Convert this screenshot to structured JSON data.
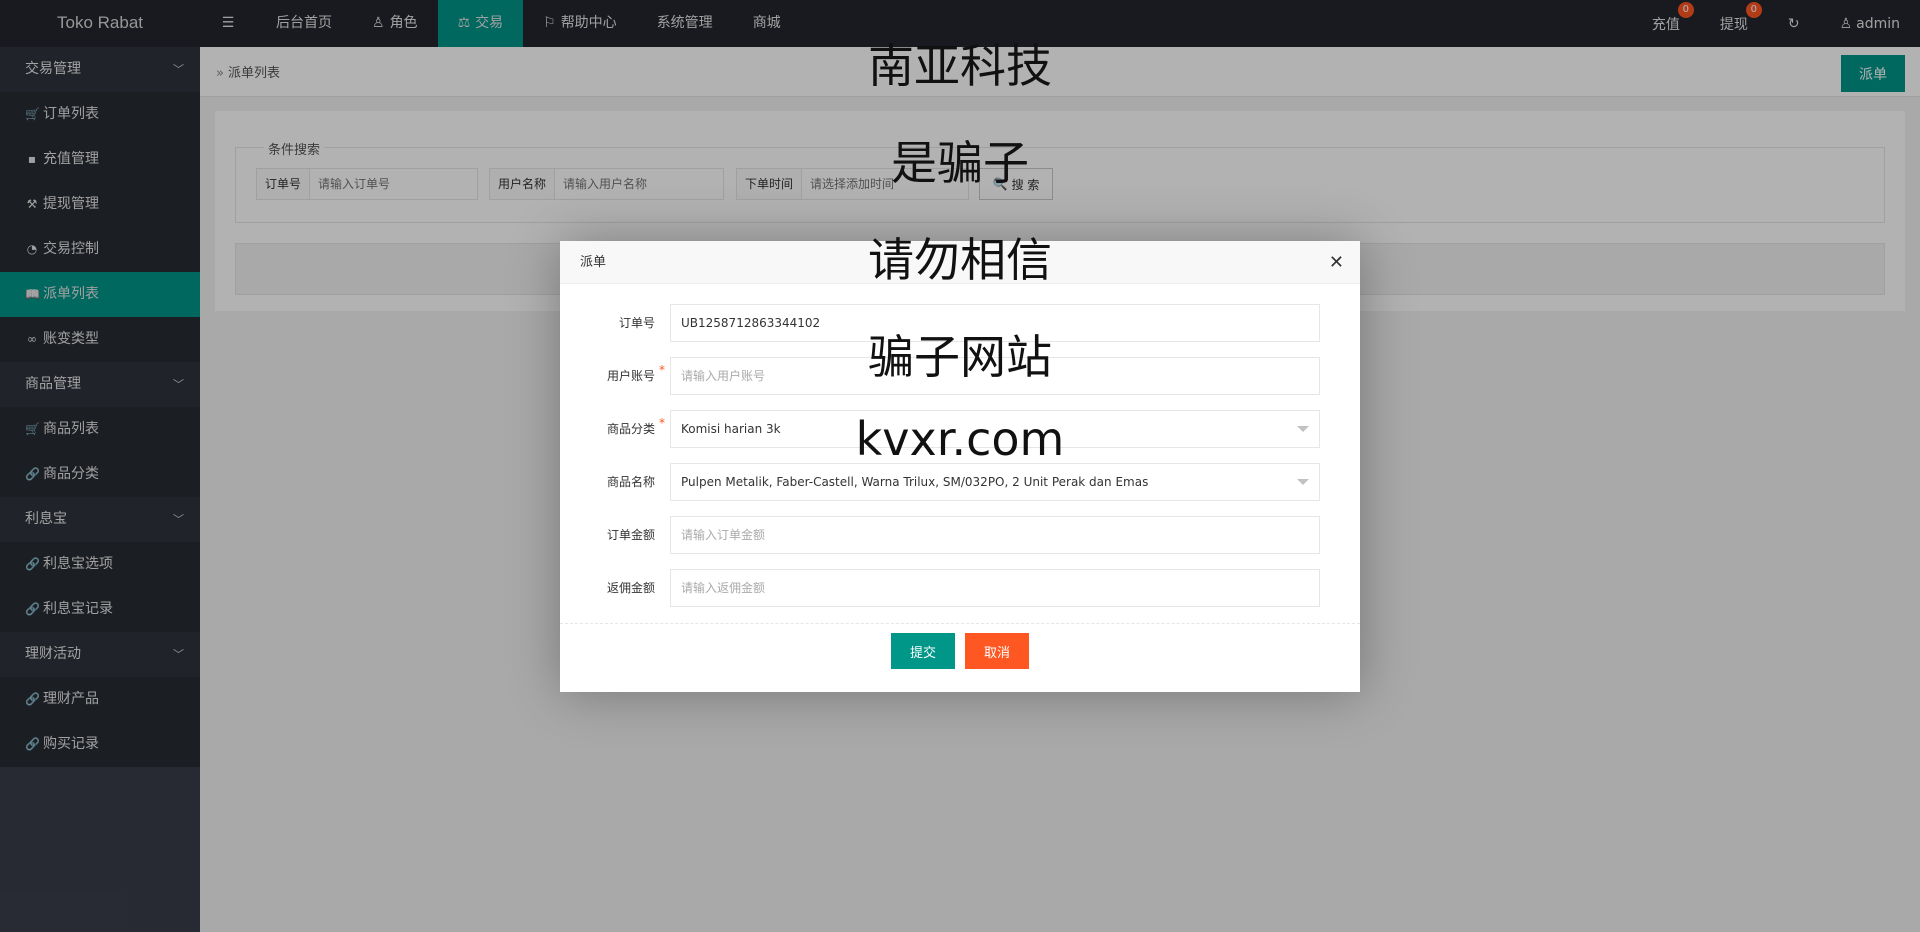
{
  "topbar": {
    "logo": "Toko Rabat",
    "menu_icon": "hamburger-icon",
    "nav": [
      {
        "label": "后台首页",
        "icon": ""
      },
      {
        "label": "角色",
        "icon": "user-icon"
      },
      {
        "label": "交易",
        "icon": "scale-icon",
        "active": true
      },
      {
        "label": "帮助中心",
        "icon": "flag-icon"
      },
      {
        "label": "系统管理",
        "icon": ""
      },
      {
        "label": "商城",
        "icon": ""
      }
    ],
    "right": {
      "recharge_label": "充值",
      "recharge_badge": "0",
      "withdraw_label": "提现",
      "withdraw_badge": "0",
      "refresh_icon": "refresh-icon",
      "user_label": "admin"
    }
  },
  "sidebar": {
    "group1": "交易管理",
    "g1_items": [
      "订单列表",
      "充值管理",
      "提现管理",
      "交易控制",
      "派单列表",
      "账变类型"
    ],
    "group2": "商品管理",
    "g2_items": [
      "商品列表",
      "商品分类"
    ],
    "group3": "利息宝",
    "g3_items": [
      "利息宝选项",
      "利息宝记录"
    ],
    "group4": "理财活动",
    "g4_items": [
      "理财产品",
      "购买记录"
    ]
  },
  "main": {
    "breadcrumb": "派单列表",
    "top_button": "派单",
    "search": {
      "legend": "条件搜索",
      "order_label": "订单号",
      "order_placeholder": "请输入订单号",
      "user_label": "用户名称",
      "user_placeholder": "请输入用户名称",
      "time_label": "下单时间",
      "time_placeholder": "请选择添加时间",
      "button": "搜 索"
    }
  },
  "modal": {
    "title": "派单",
    "fields": {
      "order_no_label": "订单号",
      "order_no_value": "UB1258712863344102",
      "account_label": "用户账号",
      "account_placeholder": "请输入用户账号",
      "category_label": "商品分类",
      "category_value": "Komisi harian 3k",
      "product_label": "商品名称",
      "product_value": "Pulpen Metalik, Faber-Castell, Warna Trilux, SM/032PO, 2 Unit Perak dan Emas",
      "amount_label": "订单金额",
      "amount_placeholder": "请输入订单金额",
      "rebate_label": "返佣金额",
      "rebate_placeholder": "请输入返佣金额"
    },
    "submit": "提交",
    "cancel": "取消"
  },
  "watermark": {
    "line1": "南亚科技",
    "line2": "是骗子",
    "line3": "请勿相信",
    "line4": "骗子网站",
    "line5": "kvxr.com"
  },
  "colors": {
    "accent": "#009688",
    "danger": "#ff5722",
    "topbar": "#23262e",
    "sidebar": "#393d49"
  }
}
